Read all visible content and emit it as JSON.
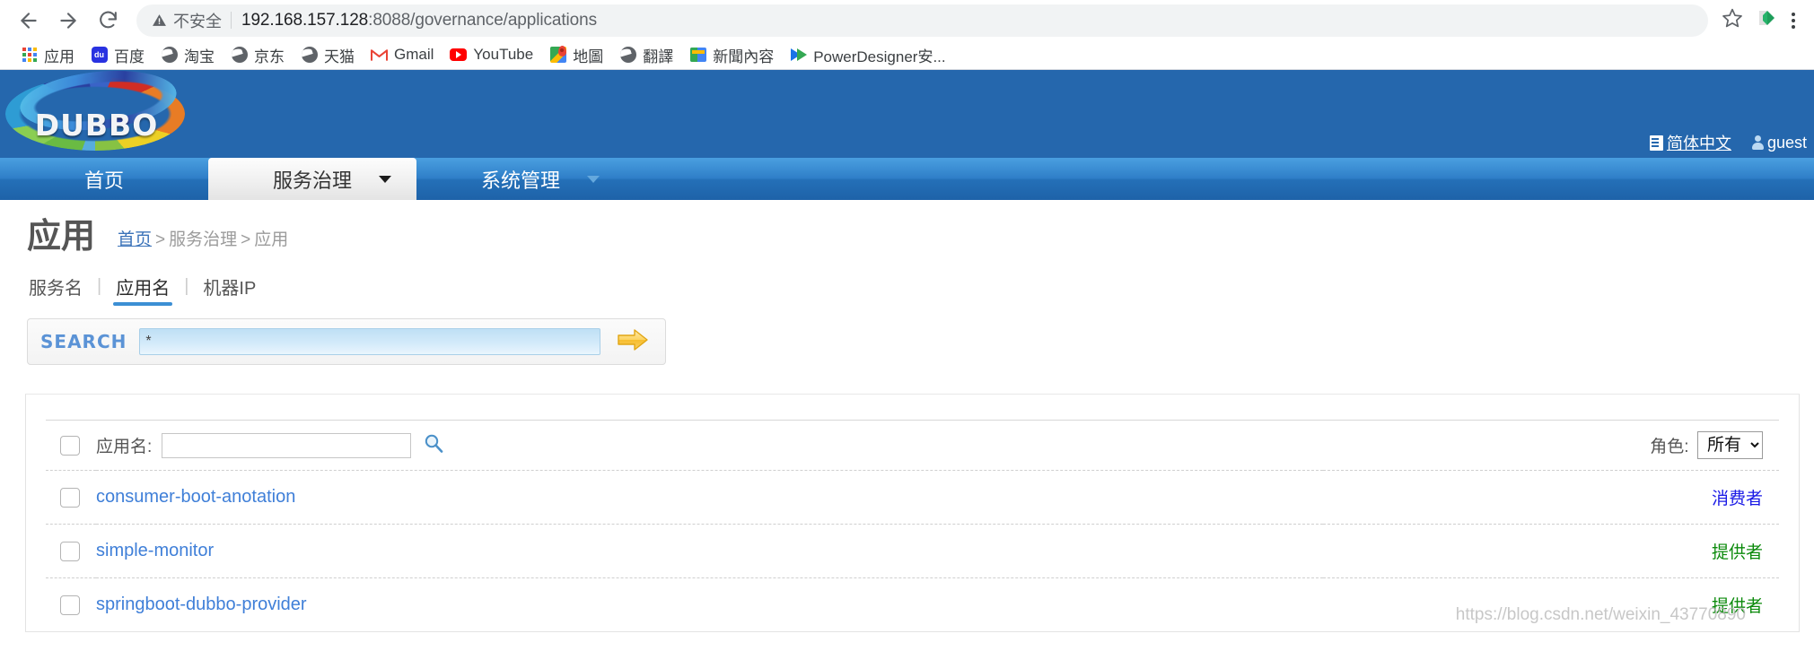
{
  "browser": {
    "back_icon": "back-arrow-icon",
    "forward_icon": "forward-arrow-icon",
    "reload_icon": "reload-icon",
    "security_label": "不安全",
    "security_icon": "warning-triangle-icon",
    "url_host": "192.168.157.128",
    "url_path": ":8088/governance/applications",
    "url_full": "192.168.157.128:8088/governance/applications",
    "star_icon": "bookmark-star-icon",
    "extension_icon": "extension-icon",
    "menu_icon": "three-dot-menu-icon",
    "bookmarks": [
      {
        "label": "应用",
        "icon": "apps-grid-icon"
      },
      {
        "label": "百度",
        "icon": "baidu-icon"
      },
      {
        "label": "淘宝",
        "icon": "globe-icon"
      },
      {
        "label": "京东",
        "icon": "globe-icon"
      },
      {
        "label": "天猫",
        "icon": "globe-icon"
      },
      {
        "label": "Gmail",
        "icon": "gmail-icon"
      },
      {
        "label": "YouTube",
        "icon": "youtube-icon"
      },
      {
        "label": "地圖",
        "icon": "google-maps-icon"
      },
      {
        "label": "翻譯",
        "icon": "globe-icon"
      },
      {
        "label": "新聞內容",
        "icon": "google-news-icon"
      },
      {
        "label": "PowerDesigner安...",
        "icon": "powerdesigner-icon"
      }
    ]
  },
  "banner": {
    "logo_text": "DUBBO",
    "language_link": "简体中文",
    "language_icon": "language-page-icon",
    "user_name": "guest",
    "user_icon": "user-avatar-icon"
  },
  "nav": {
    "tabs": [
      {
        "label": "首页",
        "active": false,
        "has_caret": false
      },
      {
        "label": "服务治理",
        "active": true,
        "has_caret": true
      },
      {
        "label": "系统管理",
        "active": false,
        "has_caret": true
      }
    ]
  },
  "page": {
    "title": "应用",
    "breadcrumb": {
      "home": "首页",
      "sep1": ">",
      "middle": "服务治理",
      "sep2": ">",
      "current": "应用"
    },
    "subtabs": [
      {
        "label": "服务名",
        "active": false
      },
      {
        "label": "应用名",
        "active": true
      },
      {
        "label": "机器IP",
        "active": false
      }
    ],
    "subtab_sep": "|"
  },
  "search": {
    "label": "SEARCH",
    "value": "*",
    "placeholder": "",
    "go_icon": "arrow-right-go-icon"
  },
  "table": {
    "header": {
      "name_label": "应用名:",
      "name_value": "",
      "name_placeholder": "",
      "search_icon": "magnifier-icon",
      "role_label": "角色:",
      "role_value": "所有",
      "role_options": [
        "所有"
      ]
    },
    "rows": [
      {
        "name": "consumer-boot-anotation",
        "role": "消费者",
        "role_type": "consumer"
      },
      {
        "name": "simple-monitor",
        "role": "提供者",
        "role_type": "provider"
      },
      {
        "name": "springboot-dubbo-provider",
        "role": "提供者",
        "role_type": "provider"
      }
    ]
  },
  "watermark": {
    "text": "https://blog.csdn.net/weixin_43770890"
  },
  "colors": {
    "banner_blue": "#2567ad",
    "nav_blue": "#2f7fc8",
    "link_blue": "#3f7fd8",
    "consumer": "#1a1ae6",
    "provider": "#0b8a0b",
    "accent_underline": "#3c8fd4"
  }
}
